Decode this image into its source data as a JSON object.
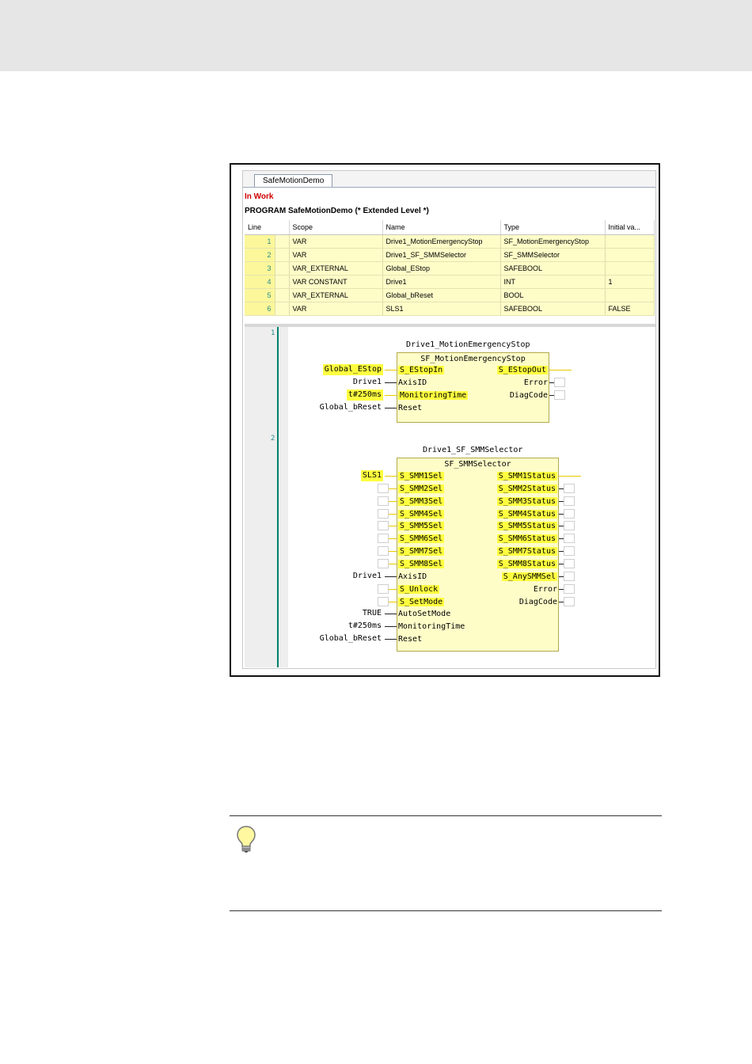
{
  "editor": {
    "tab_label": "SafeMotionDemo",
    "status": "In Work",
    "program_header": "PROGRAM SafeMotionDemo (* Extended Level *)"
  },
  "var_table": {
    "columns": [
      "Line",
      "Scope",
      "Name",
      "Type",
      "Initial va..."
    ],
    "rows": [
      {
        "line": "1",
        "scope": "VAR",
        "name": "Drive1_MotionEmergencyStop",
        "type": "SF_MotionEmergencyStop",
        "init": ""
      },
      {
        "line": "2",
        "scope": "VAR",
        "name": "Drive1_SF_SMMSelector",
        "type": "SF_SMMSelector",
        "init": ""
      },
      {
        "line": "3",
        "scope": "VAR_EXTERNAL",
        "name": "Global_EStop",
        "type": "SAFEBOOL",
        "init": ""
      },
      {
        "line": "4",
        "scope": "VAR CONSTANT",
        "name": "Drive1",
        "type": "INT",
        "init": "1"
      },
      {
        "line": "5",
        "scope": "VAR_EXTERNAL",
        "name": "Global_bReset",
        "type": "BOOL",
        "init": ""
      },
      {
        "line": "6",
        "scope": "VAR",
        "name": "SLS1",
        "type": "SAFEBOOL",
        "init": "FALSE"
      }
    ]
  },
  "network1": {
    "number": "1",
    "instance": "Drive1_MotionEmergencyStop",
    "block_type": "SF_MotionEmergencyStop",
    "inputs": [
      {
        "pin": "S_EStopIn",
        "source": "Global_EStop",
        "highlight": true
      },
      {
        "pin": "AxisID",
        "source": "Drive1",
        "highlight": false
      },
      {
        "pin": "MonitoringTime",
        "source": "t#250ms",
        "highlight": true
      },
      {
        "pin": "Reset",
        "source": "Global_bReset",
        "highlight": false
      }
    ],
    "outputs": [
      {
        "pin": "S_EStopOut",
        "highlight": true
      },
      {
        "pin": "Error",
        "highlight": false
      },
      {
        "pin": "DiagCode",
        "highlight": false
      }
    ]
  },
  "network2": {
    "number": "2",
    "instance": "Drive1_SF_SMMSelector",
    "block_type": "SF_SMMSelector",
    "inputs": [
      {
        "pin": "S_SMM1Sel",
        "source": "SLS1",
        "highlight": true
      },
      {
        "pin": "S_SMM2Sel",
        "source": "",
        "highlight": true
      },
      {
        "pin": "S_SMM3Sel",
        "source": "",
        "highlight": true
      },
      {
        "pin": "S_SMM4Sel",
        "source": "",
        "highlight": true
      },
      {
        "pin": "S_SMM5Sel",
        "source": "",
        "highlight": true
      },
      {
        "pin": "S_SMM6Sel",
        "source": "",
        "highlight": true
      },
      {
        "pin": "S_SMM7Sel",
        "source": "",
        "highlight": true
      },
      {
        "pin": "S_SMM8Sel",
        "source": "",
        "highlight": true
      },
      {
        "pin": "AxisID",
        "source": "Drive1",
        "highlight": false
      },
      {
        "pin": "S_Unlock",
        "source": "",
        "highlight": true
      },
      {
        "pin": "S_SetMode",
        "source": "",
        "highlight": true
      },
      {
        "pin": "AutoSetMode",
        "source": "TRUE",
        "highlight": false
      },
      {
        "pin": "MonitoringTime",
        "source": "t#250ms",
        "highlight": false
      },
      {
        "pin": "Reset",
        "source": "Global_bReset",
        "highlight": false
      }
    ],
    "outputs": [
      {
        "pin": "S_SMM1Status",
        "highlight": true
      },
      {
        "pin": "S_SMM2Status",
        "highlight": true
      },
      {
        "pin": "S_SMM3Status",
        "highlight": true
      },
      {
        "pin": "S_SMM4Status",
        "highlight": true
      },
      {
        "pin": "S_SMM5Status",
        "highlight": true
      },
      {
        "pin": "S_SMM6Status",
        "highlight": true
      },
      {
        "pin": "S_SMM7Status",
        "highlight": true
      },
      {
        "pin": "S_SMM8Status",
        "highlight": true
      },
      {
        "pin": "S_AnySMMSel",
        "highlight": true
      },
      {
        "pin": "Error",
        "highlight": false
      },
      {
        "pin": "DiagCode",
        "highlight": false
      }
    ]
  },
  "tip": {
    "icon": "lightbulb-icon"
  },
  "colors": {
    "highlight": "#ffff40",
    "rail": "#00806e",
    "status": "#d00000",
    "block_fill": "#fefdc8"
  }
}
